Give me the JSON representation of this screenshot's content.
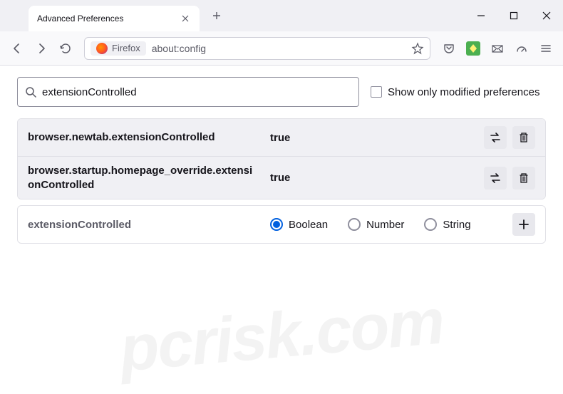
{
  "window": {
    "tab_title": "Advanced Preferences"
  },
  "urlbar": {
    "identity_label": "Firefox",
    "url": "about:config"
  },
  "search": {
    "value": "extensionControlled",
    "checkbox_label": "Show only modified preferences"
  },
  "prefs": [
    {
      "name": "browser.newtab.extensionControlled",
      "value": "true"
    },
    {
      "name": "browser.startup.homepage_override.extensionControlled",
      "value": "true"
    }
  ],
  "create": {
    "name": "extensionControlled",
    "types": [
      "Boolean",
      "Number",
      "String"
    ],
    "selected": "Boolean"
  },
  "watermark": "pcrisk.com"
}
